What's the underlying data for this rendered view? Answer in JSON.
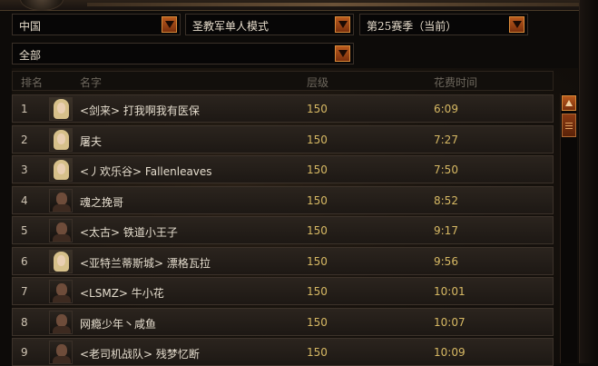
{
  "filters": {
    "region": "中国",
    "mode": "圣教军单人模式",
    "season": "第25赛季（当前）",
    "class": "全部"
  },
  "table": {
    "columns": [
      "排名",
      "名字",
      "层级",
      "花费时间"
    ],
    "rows": [
      {
        "rank": "1",
        "name": "<剑来> 打我啊我有医保",
        "level": "150",
        "time": "6:09",
        "avatar": "female"
      },
      {
        "rank": "2",
        "name": "屠夫",
        "level": "150",
        "time": "7:27",
        "avatar": "female"
      },
      {
        "rank": "3",
        "name": "<丿欢乐谷> Fallenleaves",
        "level": "150",
        "time": "7:50",
        "avatar": "female"
      },
      {
        "rank": "4",
        "name": "魂之挽哥",
        "level": "150",
        "time": "8:52",
        "avatar": "male"
      },
      {
        "rank": "5",
        "name": "<太古> 铁道小王子",
        "level": "150",
        "time": "9:17",
        "avatar": "male"
      },
      {
        "rank": "6",
        "name": "<亚特兰蒂斯城> 漂格瓦拉",
        "level": "150",
        "time": "9:56",
        "avatar": "female"
      },
      {
        "rank": "7",
        "name": "<LSMZ> 牛小花",
        "level": "150",
        "time": "10:01",
        "avatar": "male"
      },
      {
        "rank": "8",
        "name": "网瘾少年丶咸鱼",
        "level": "150",
        "time": "10:07",
        "avatar": "male"
      },
      {
        "rank": "9",
        "name": "<老司机战队> 残梦忆断",
        "level": "150",
        "time": "10:09",
        "avatar": "male"
      }
    ]
  },
  "icons": {
    "dropdown_arrow": "triangle-down",
    "scroll_up": "triangle-up"
  },
  "colors": {
    "accent": "#b95a1e",
    "value_text": "#d7b964"
  }
}
